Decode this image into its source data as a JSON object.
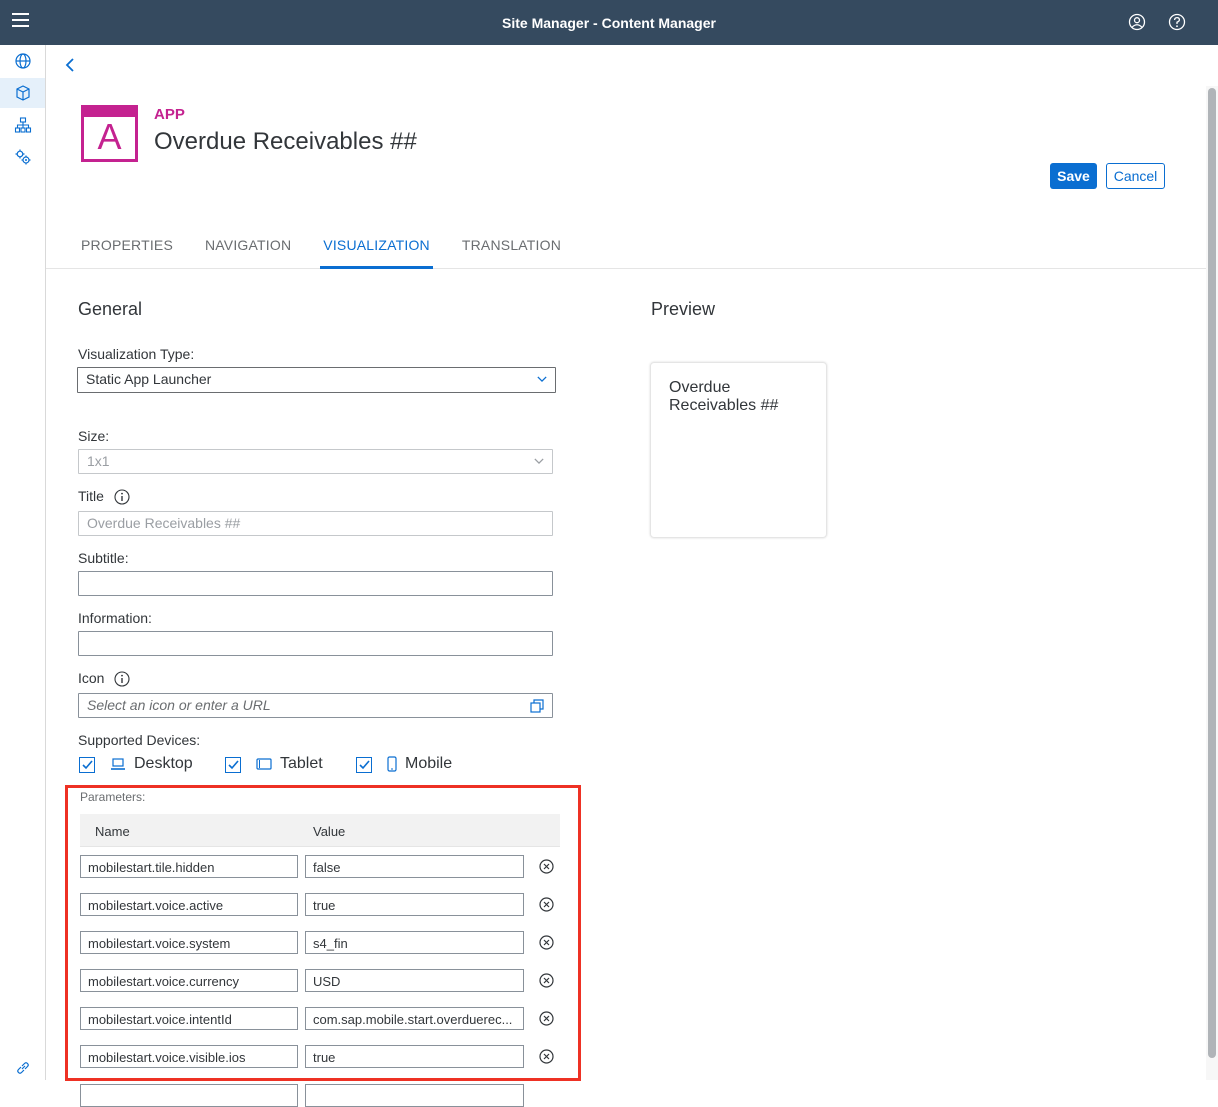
{
  "shell": {
    "title": "Site Manager - Content Manager",
    "menu_icon": "hamburger-menu-icon",
    "user_icon": "user-icon",
    "help_icon": "help-icon"
  },
  "sidebar": {
    "items": [
      {
        "icon": "globe-icon"
      },
      {
        "icon": "content-cube-icon",
        "active": true
      },
      {
        "icon": "sitemap-icon"
      },
      {
        "icon": "settings-gears-icon"
      }
    ],
    "footer_icon": "link-icon"
  },
  "header": {
    "type": "APP",
    "icon_letter": "A",
    "title": "Overdue Receivables ##",
    "save_label": "Save",
    "cancel_label": "Cancel"
  },
  "tabs": [
    {
      "label": "PROPERTIES"
    },
    {
      "label": "NAVIGATION"
    },
    {
      "label": "VISUALIZATION",
      "active": true
    },
    {
      "label": "TRANSLATION"
    }
  ],
  "general": {
    "heading": "General",
    "visualization_type_label": "Visualization Type:",
    "visualization_type_value": "Static App Launcher",
    "size_label": "Size:",
    "size_value": "1x1",
    "title_label": "Title",
    "title_value": "Overdue Receivables ##",
    "subtitle_label": "Subtitle:",
    "subtitle_value": "",
    "information_label": "Information:",
    "information_value": "",
    "icon_label": "Icon",
    "icon_placeholder": "Select an icon or enter a URL",
    "devices_label": "Supported Devices:",
    "devices": [
      {
        "label": "Desktop",
        "checked": true
      },
      {
        "label": "Tablet",
        "checked": true
      },
      {
        "label": "Mobile",
        "checked": true
      }
    ],
    "parameters_label": "Parameters:",
    "param_columns": [
      "Name",
      "Value"
    ],
    "parameters": [
      {
        "name": "mobilestart.tile.hidden",
        "value": "false"
      },
      {
        "name": "mobilestart.voice.active",
        "value": "true"
      },
      {
        "name": "mobilestart.voice.system",
        "value": "s4_fin"
      },
      {
        "name": "mobilestart.voice.currency",
        "value": "USD"
      },
      {
        "name": "mobilestart.voice.intentId",
        "value": "com.sap.mobile.start.overduerec..."
      },
      {
        "name": "mobilestart.voice.visible.ios",
        "value": "true"
      },
      {
        "name": "",
        "value": ""
      }
    ]
  },
  "preview": {
    "heading": "Preview",
    "tile_title": "Overdue Receivables ##"
  },
  "colors": {
    "shell": "#354a5f",
    "accent": "#0a6ed1",
    "app_magenta": "#c42290",
    "highlight_red": "#ee3124"
  }
}
